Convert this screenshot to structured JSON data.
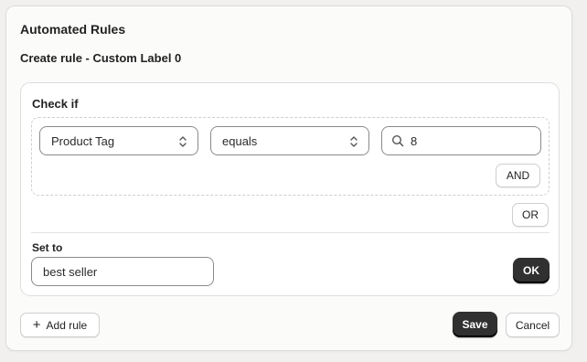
{
  "header": {
    "title": "Automated Rules",
    "subtitle": "Create rule - Custom Label 0"
  },
  "rule": {
    "check_if_label": "Check if",
    "condition": {
      "field_value": "Product Tag",
      "operator_value": "equals",
      "match_value": "8"
    },
    "and_label": "AND",
    "or_label": "OR",
    "set_to_label": "Set to",
    "set_to_value": "best seller",
    "ok_label": "OK"
  },
  "footer": {
    "add_rule_label": "Add rule",
    "save_label": "Save",
    "cancel_label": "Cancel"
  },
  "colors": {
    "primary_button": "#303030",
    "card_background": "#fbfbfa",
    "page_background": "#f1f0ee"
  },
  "icons": {
    "select_chevron": "chevron-up-down-icon",
    "search": "search-icon",
    "add": "plus-icon"
  }
}
